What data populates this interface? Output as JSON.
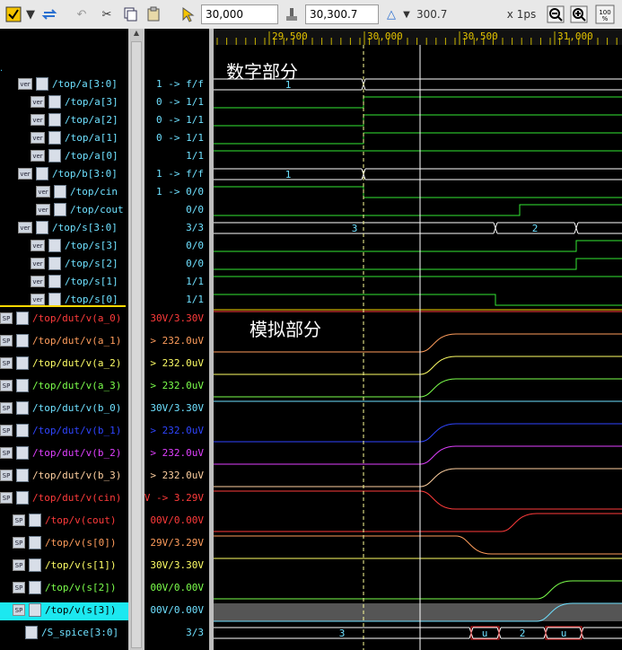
{
  "toolbar": {
    "cursor_time": "30,000",
    "cursor2_time": "30,300.7",
    "delta_value": "300.7",
    "time_unit": "x 1ps"
  },
  "ruler": {
    "ticks": [
      "29,500",
      "30,000",
      "30,500",
      "31,000"
    ]
  },
  "annotations": {
    "digital": "数字部分",
    "analog": "模拟部分"
  },
  "digital_signals": [
    {
      "name": "/top/a[3:0]",
      "badge": "ver",
      "icon": "bus-icon",
      "value": "1 -> f/f",
      "color": "#6ee0ff",
      "indent": 0
    },
    {
      "name": "/top/a[3]",
      "badge": "ver",
      "icon": "wire-icon",
      "value": "0 -> 1/1",
      "color": "#6ee0ff",
      "indent": 1
    },
    {
      "name": "/top/a[2]",
      "badge": "ver",
      "icon": "wire-icon",
      "value": "0 -> 1/1",
      "color": "#6ee0ff",
      "indent": 1
    },
    {
      "name": "/top/a[1]",
      "badge": "ver",
      "icon": "wire-icon",
      "value": "0 -> 1/1",
      "color": "#6ee0ff",
      "indent": 1
    },
    {
      "name": "/top/a[0]",
      "badge": "ver",
      "icon": "wire-icon",
      "value": "1/1",
      "color": "#6ee0ff",
      "indent": 1
    },
    {
      "name": "/top/b[3:0]",
      "badge": "ver",
      "icon": "bus-icon",
      "value": "1 -> f/f",
      "color": "#6ee0ff",
      "indent": 0
    },
    {
      "name": "/top/cin",
      "badge": "ver",
      "icon": "bus-icon",
      "value": "1 -> 0/0",
      "color": "#6ee0ff",
      "indent": 2
    },
    {
      "name": "/top/cout",
      "badge": "ver",
      "icon": "net-icon",
      "value": "0/0",
      "color": "#6ee0ff",
      "indent": 2
    },
    {
      "name": "/top/s[3:0]",
      "badge": "ver",
      "icon": "net-icon",
      "value": "3/3",
      "color": "#6ee0ff",
      "indent": 0
    },
    {
      "name": "/top/s[3]",
      "badge": "ver",
      "icon": "wire-icon",
      "value": "0/0",
      "color": "#6ee0ff",
      "indent": 1
    },
    {
      "name": "/top/s[2]",
      "badge": "ver",
      "icon": "wire-icon",
      "value": "0/0",
      "color": "#6ee0ff",
      "indent": 1
    },
    {
      "name": "/top/s[1]",
      "badge": "ver",
      "icon": "wire-icon",
      "value": "1/1",
      "color": "#6ee0ff",
      "indent": 1
    },
    {
      "name": "/top/s[0]",
      "badge": "ver",
      "icon": "wire-icon",
      "value": "1/1",
      "color": "#6ee0ff",
      "indent": 1
    }
  ],
  "analog_signals": [
    {
      "name": "/top/dut/v(a_0)",
      "badge": "SP",
      "value": "30V/3.30V",
      "color": "#ff3b3b"
    },
    {
      "name": "/top/dut/v(a_1)",
      "badge": "SP",
      "value": "> 232.0uV",
      "color": "#ff9d5c"
    },
    {
      "name": "/top/dut/v(a_2)",
      "badge": "SP",
      "value": "> 232.0uV",
      "color": "#ffff66"
    },
    {
      "name": "/top/dut/v(a_3)",
      "badge": "SP",
      "value": "> 232.0uV",
      "color": "#7cff4c"
    },
    {
      "name": "/top/dut/v(b_0)",
      "badge": "SP",
      "value": "30V/3.30V",
      "color": "#6ee0ff"
    },
    {
      "name": "/top/dut/v(b_1)",
      "badge": "SP",
      "value": "> 232.0uV",
      "color": "#2f45ff"
    },
    {
      "name": "/top/dut/v(b_2)",
      "badge": "SP",
      "value": "> 232.0uV",
      "color": "#e040ff"
    },
    {
      "name": "/top/dut/v(b_3)",
      "badge": "SP",
      "value": "> 232.0uV",
      "color": "#ffd0a0"
    },
    {
      "name": "/top/dut/v(cin)",
      "badge": "SP",
      "value": "V -> 3.29V",
      "color": "#ff3b3b"
    },
    {
      "name": "/top/v(cout)",
      "badge": "SP",
      "value": "00V/0.00V",
      "color": "#ff3b3b"
    },
    {
      "name": "/top/v(s[0])",
      "badge": "SP",
      "value": "29V/3.29V",
      "color": "#ff9d5c"
    },
    {
      "name": "/top/v(s[1])",
      "badge": "SP",
      "value": "30V/3.30V",
      "color": "#ffff66"
    },
    {
      "name": "/top/v(s[2])",
      "badge": "SP",
      "value": "00V/0.00V",
      "color": "#7cff4c"
    },
    {
      "name": "/top/v(s[3])",
      "badge": "SP",
      "value": "00V/0.00V",
      "color": "#6ee0ff",
      "selected": true
    }
  ],
  "spice_bus": {
    "name": "/S_spice[3:0]",
    "value": "3/3",
    "color": "#6ee0ff"
  },
  "bus_labels": {
    "a_before": "1",
    "b_before": "1",
    "s_val1": "3",
    "s_val2": "2",
    "spice_vals": [
      "3",
      "u",
      "2",
      "u"
    ]
  },
  "colors": {
    "digital_wave": "#34e834",
    "bus_wave": "#ffffff",
    "cyan_wave": "#6ee0ff",
    "cursor_line": "#ffffff",
    "selection": "#1ce8f0"
  }
}
